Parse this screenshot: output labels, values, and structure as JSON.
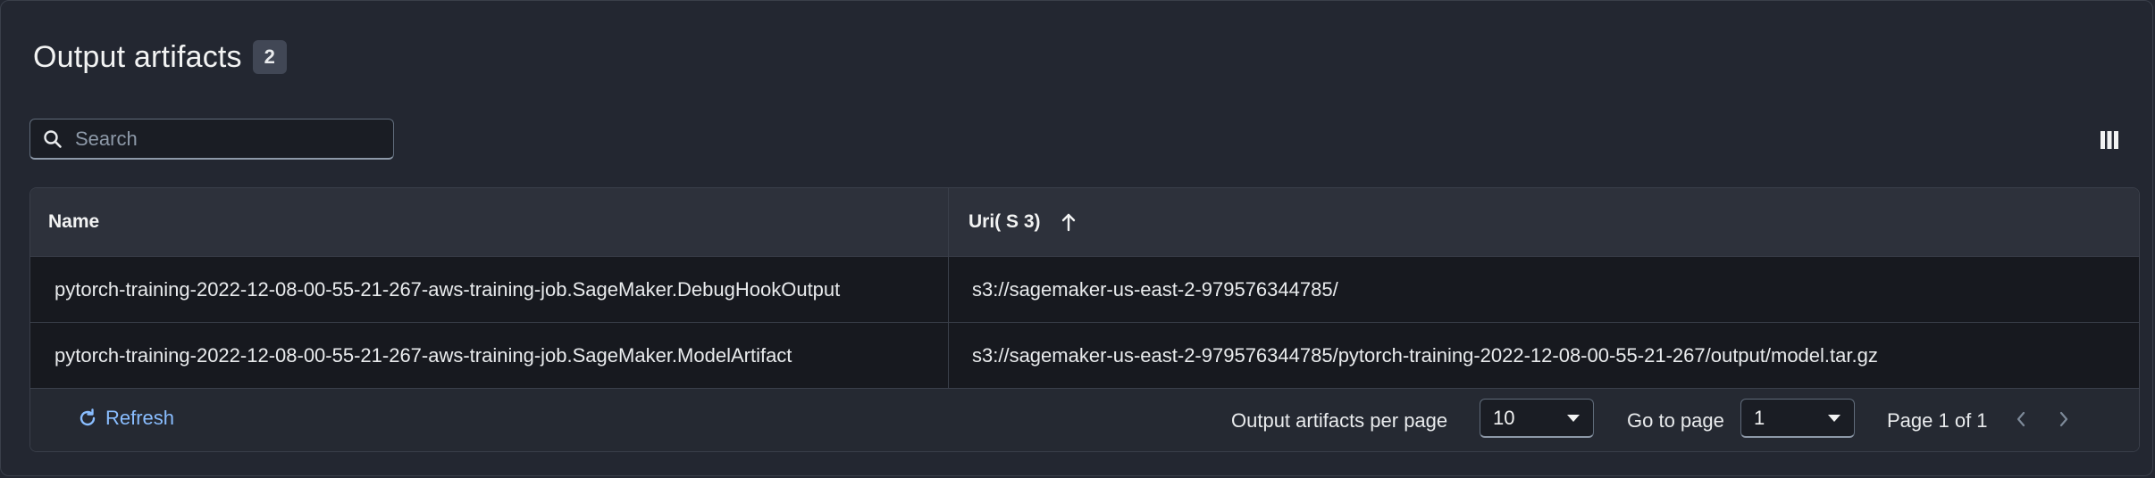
{
  "header": {
    "title": "Output artifacts",
    "count": "2"
  },
  "search": {
    "placeholder": "Search",
    "value": ""
  },
  "table": {
    "columns": {
      "name": "Name",
      "uri": "Uri( S 3)"
    },
    "sort": {
      "column": "uri",
      "direction": "ascending"
    },
    "rows": [
      {
        "name": "pytorch-training-2022-12-08-00-55-21-267-aws-training-job.SageMaker.DebugHookOutput",
        "uri": "s3://sagemaker-us-east-2-979576344785/"
      },
      {
        "name": "pytorch-training-2022-12-08-00-55-21-267-aws-training-job.SageMaker.ModelArtifact",
        "uri": "s3://sagemaker-us-east-2-979576344785/pytorch-training-2022-12-08-00-55-21-267/output/model.tar.gz"
      }
    ]
  },
  "footer": {
    "refresh_label": "Refresh",
    "per_page_label": "Output artifacts per page",
    "per_page_value": "10",
    "go_to_label": "Go to page",
    "go_to_value": "1",
    "page_status": "Page 1 of 1"
  },
  "icons": {
    "search": "search-icon",
    "column_prefs": "columns-icon",
    "sort": "arrow-up-icon",
    "refresh": "refresh-icon",
    "dropdown": "caret-down-icon",
    "prev": "chevron-left-icon",
    "next": "chevron-right-icon"
  },
  "colors": {
    "background": "#232731",
    "link": "#89bdff",
    "header_row": "#2d313b",
    "row": "#17191f"
  }
}
